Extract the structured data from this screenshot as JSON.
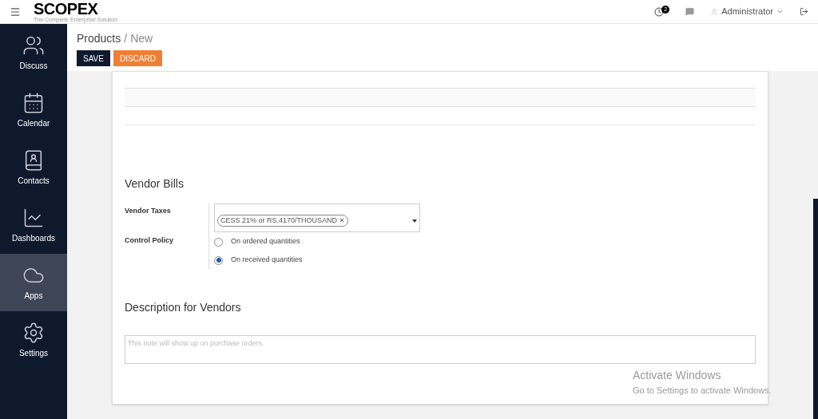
{
  "topbar": {
    "logo": "SCOPEX",
    "tagline": "The Complete Enterprise Solution",
    "activity_count": "2",
    "user": "Administrator"
  },
  "sidebar": {
    "items": [
      {
        "label": "Discuss",
        "kind": "discuss",
        "selected": false
      },
      {
        "label": "Calendar",
        "kind": "calendar",
        "selected": false
      },
      {
        "label": "Contacts",
        "kind": "contacts",
        "selected": false
      },
      {
        "label": "Dashboards",
        "kind": "dashboards",
        "selected": false
      },
      {
        "label": "Apps",
        "kind": "apps",
        "selected": true
      },
      {
        "label": "Settings",
        "kind": "settings",
        "selected": false
      }
    ]
  },
  "breadcrumb": {
    "parent": "Products",
    "separator": "/",
    "current": "New"
  },
  "buttons": {
    "save": "SAVE",
    "discard": "DISCARD"
  },
  "vendor_bills": {
    "title": "Vendor Bills",
    "taxes_label": "Vendor Taxes",
    "tax_tag": "CESS 21% or RS.4170/THOUSAND",
    "policy_label": "Control Policy",
    "options": [
      {
        "label": "On ordered quantities",
        "selected": false
      },
      {
        "label": "On received quantities",
        "selected": true
      }
    ]
  },
  "description": {
    "title": "Description for Vendors",
    "placeholder": "This note will show up on purchase orders."
  },
  "activation": {
    "title": "Activate Windows",
    "subtitle": "Go to Settings to activate Windows."
  }
}
